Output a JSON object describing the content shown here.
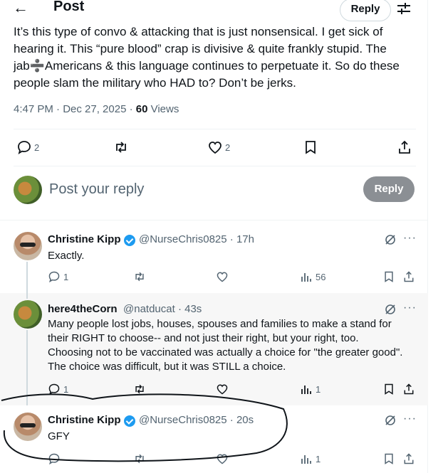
{
  "header": {
    "title": "Post",
    "reply_label": "Reply"
  },
  "post": {
    "text": "It’s this type of convo & attacking that is just nonsensical. I get sick of hearing it. This “pure blood” crap is divisive & quite frankly stupid. The jab➗Americans & this language continues to perpetuate it. So do these people slam the military who HAD to? Don’t be jerks.",
    "time": "4:47 PM · Dec 27, 2025 · ",
    "views_count": "60",
    "views_label": " Views",
    "replies": "2",
    "likes": "2"
  },
  "compose": {
    "placeholder": "Post your reply",
    "button": "Reply"
  },
  "replies": [
    {
      "name": "Christine Kipp",
      "handle_time": "@NurseChris0825 · 17h",
      "text": "Exactly.",
      "replies": "1",
      "views": "56"
    },
    {
      "name": "here4theCorn",
      "handle_time": "@natducat · 43s",
      "text": "Many people lost jobs, houses, spouses and families to make a stand for their RIGHT to choose-- and not just their right, but your right, too. Choosing not to be vaccinated was actually a choice for \"the greater good\". The choice was difficult, but it was STILL a choice.",
      "replies": "1",
      "views": "1"
    },
    {
      "name": "Christine Kipp",
      "handle_time": "@NurseChris0825 · 20s",
      "text": "GFY",
      "views": "1"
    }
  ],
  "colors": {
    "accent": "#1d9bf0",
    "muted": "#536471",
    "highlight_bg": "#f7f7f7"
  }
}
